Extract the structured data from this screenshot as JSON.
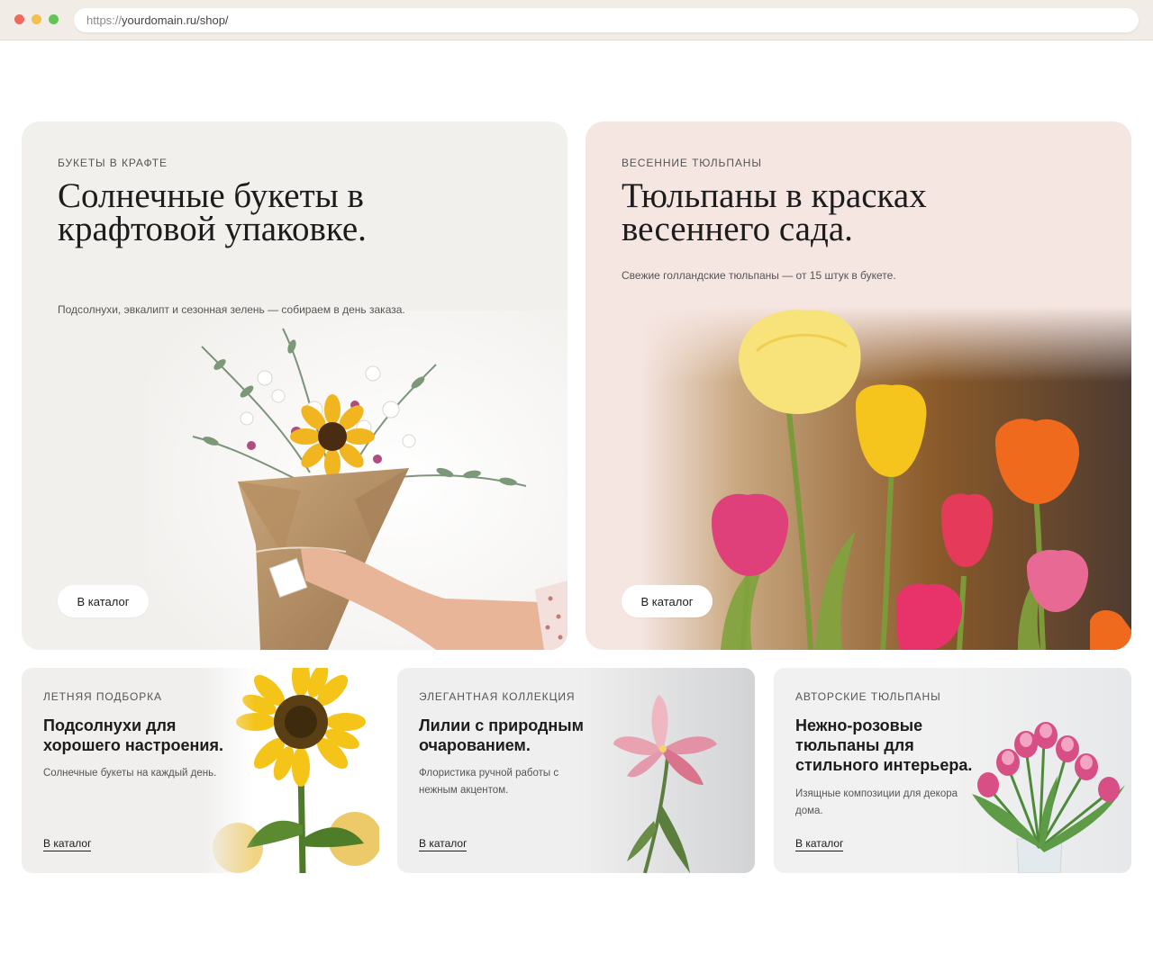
{
  "browser": {
    "url_protocol": "https://",
    "url_rest": "yourdomain.ru/shop/"
  },
  "cards": {
    "kraft": {
      "kicker": "Букеты в крафте",
      "title": "Солнечные букеты в крафтовой упаковке.",
      "subtitle": "Подсолнухи, эвкалипт и сезонная зелень — собираем в день заказа.",
      "button": "В каталог"
    },
    "tulips": {
      "kicker": "Весенние тюльпаны",
      "title": "Тюльпаны в красках весеннего сада.",
      "subtitle": "Свежие голландские тюльпаны — от 15 штук в букете.",
      "button": "В каталог"
    },
    "sunflowers": {
      "kicker": "Летняя подборка",
      "title": "Подсолнухи для хорошего настроения.",
      "subtitle": "Солнечные букеты на каждый день.",
      "link": "В каталог"
    },
    "lilies": {
      "kicker": "Элегантная коллекция",
      "title": "Лилии с природным очарованием.",
      "subtitle": "Флористика ручной работы с нежным акцентом.",
      "link": "В каталог"
    },
    "pink_tulips": {
      "kicker": "Авторские тюльпаны",
      "title": "Нежно-розовые тюльпаны для стильного интерьера.",
      "subtitle": "Изящные композиции для декора дома.",
      "link": "В каталог"
    }
  },
  "colors": {
    "kraft_bg": "#f2f0ed",
    "tulips_bg": "#f6e6e2",
    "small_bg": "#f0efee",
    "text": "#1c1c1c"
  }
}
